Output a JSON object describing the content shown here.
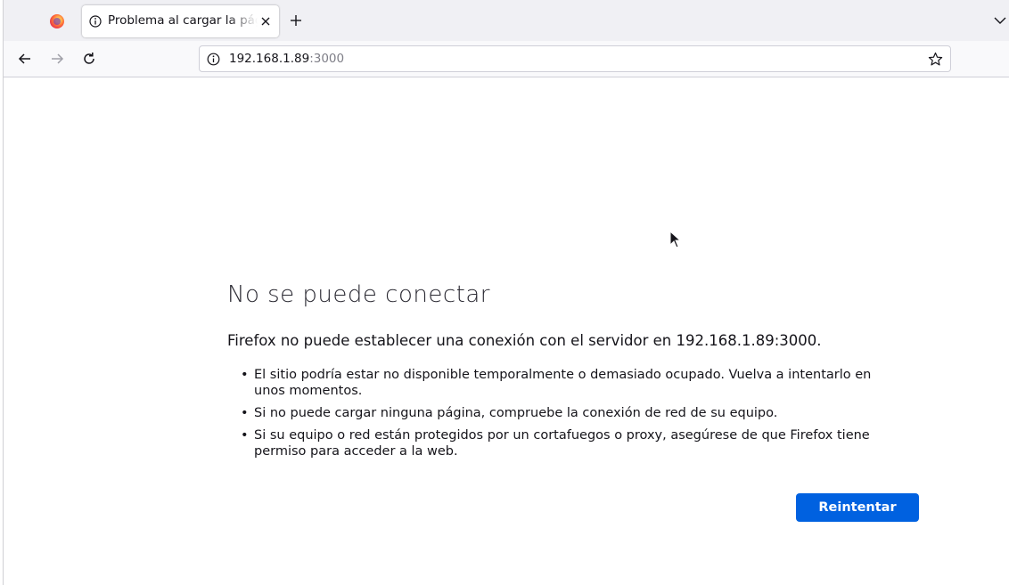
{
  "browser": {
    "tab": {
      "title": "Problema al cargar la página"
    },
    "address_bar": {
      "host": "192.168.1.89",
      "port": ":3000"
    },
    "icons": {
      "logo": "firefox-logo-icon",
      "tab_info": "info-icon",
      "tab_close": "close-icon",
      "new_tab": "plus-icon",
      "tab_list": "chevron-down-icon",
      "back": "arrow-left-icon",
      "forward": "arrow-right-icon",
      "reload": "reload-icon",
      "bookmark": "star-icon"
    }
  },
  "error_page": {
    "title": "No se puede conectar",
    "description": "Firefox no puede establecer una conexión con el servidor en 192.168.1.89:3000.",
    "bullets": [
      "El sitio podría estar no disponible temporalmente o demasiado ocupado. Vuelva a intentarlo en unos momentos.",
      "Si no puede cargar ninguna página, compruebe la conexión de red de su equipo.",
      "Si su equipo o red están protegidos por un cortafuegos o proxy, asegúrese de que Firefox tiene permiso para acceder a la web."
    ],
    "retry_label": "Reintentar"
  },
  "colors": {
    "accent": "#0061e0",
    "tabstrip_bg": "#f0f0f4",
    "navbar_bg": "#f9f9fb"
  }
}
